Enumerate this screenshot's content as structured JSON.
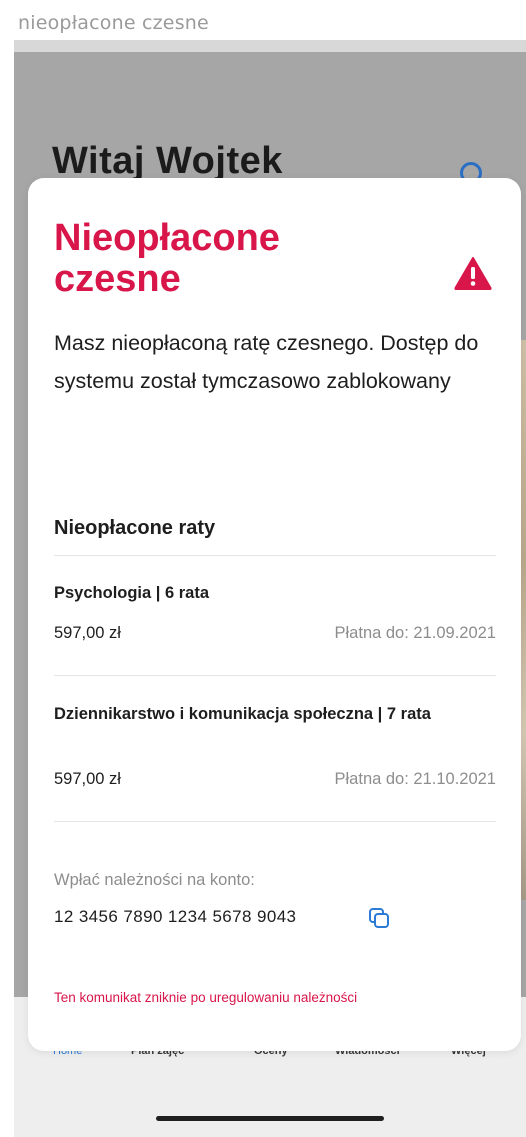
{
  "caption": "nieopłacone czesne",
  "background": {
    "greeting": "Witaj Wojtek",
    "tabs": [
      {
        "label": "Home"
      },
      {
        "label": "Plan zajęć"
      },
      {
        "label": "Oceny"
      },
      {
        "label": "Wiadomości"
      },
      {
        "label": "Więcej"
      }
    ]
  },
  "modal": {
    "title": "Nieopłacone czesne",
    "message": "Masz nieopłaconą ratę czesnego. Dostęp do systemu został tymczasowo zablokowany",
    "section_title": "Nieopłacone raty",
    "installments": [
      {
        "name": "Psychologia | 6 rata",
        "amount": "597,00 zł",
        "due": "Płatna do: 21.09.2021"
      },
      {
        "name": "Dziennikarstwo i komunikacja społeczna | 7 rata",
        "amount": "597,00 zł",
        "due": "Płatna do: 21.10.2021"
      }
    ],
    "account_label": "Wpłać należności na konto:",
    "account_number": "12 3456 7890 1234 5678 9043",
    "footer_note": "Ten komunikat zniknie po uregulowaniu należności"
  },
  "colors": {
    "accent": "#d8164a",
    "link_blue": "#2a7ad6",
    "overlay_gray": "#a6a6a6"
  },
  "icons": {
    "warning": "warning-triangle-icon",
    "copy": "copy-icon",
    "search": "search-icon"
  }
}
